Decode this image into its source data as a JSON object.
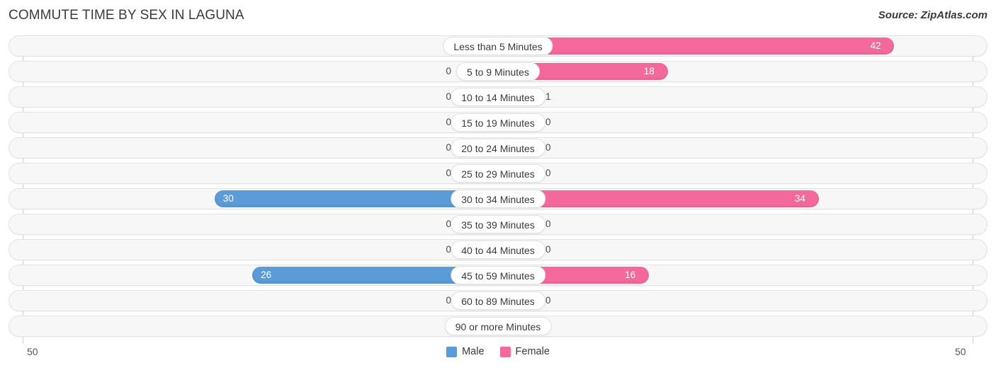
{
  "header": {
    "title": "COMMUTE TIME BY SEX IN LAGUNA",
    "source": "Source: ZipAtlas.com"
  },
  "axis": {
    "left_max_label": "50",
    "right_max_label": "50",
    "max": 50
  },
  "legend": {
    "items": [
      {
        "label": "Male",
        "color": "#5b9bd8"
      },
      {
        "label": "Female",
        "color": "#f4699b"
      }
    ]
  },
  "colors": {
    "male": "#5b9bd8",
    "male_zero": "#a8c8ea",
    "female": "#f4699b",
    "female_zero": "#f8a8c2",
    "track": "#f7f7f7",
    "track_border": "#e3e3e3"
  },
  "chart_data": {
    "type": "bar",
    "subtype": "diverging-horizontal-bar",
    "title": "COMMUTE TIME BY SEX IN LAGUNA",
    "xlabel": "",
    "ylabel": "",
    "xlim": [
      -50,
      50
    ],
    "grid": false,
    "legend_position": "bottom-center",
    "axis_tick_labels": [
      "50",
      "50"
    ],
    "categories": [
      "Less than 5 Minutes",
      "5 to 9 Minutes",
      "10 to 14 Minutes",
      "15 to 19 Minutes",
      "20 to 24 Minutes",
      "25 to 29 Minutes",
      "30 to 34 Minutes",
      "35 to 39 Minutes",
      "40 to 44 Minutes",
      "45 to 59 Minutes",
      "60 to 89 Minutes",
      "90 or more Minutes"
    ],
    "series": [
      {
        "name": "Male",
        "side": "left",
        "color": "#5b9bd8",
        "values": [
          0,
          0,
          0,
          0,
          0,
          0,
          30,
          0,
          0,
          26,
          0,
          0
        ]
      },
      {
        "name": "Female",
        "side": "right",
        "color": "#f4699b",
        "values": [
          42,
          18,
          1,
          0,
          0,
          0,
          34,
          0,
          0,
          16,
          0,
          0
        ]
      }
    ]
  },
  "rows": [
    {
      "category": "Less than 5 Minutes",
      "male": "0",
      "female": "42"
    },
    {
      "category": "5 to 9 Minutes",
      "male": "0",
      "female": "18"
    },
    {
      "category": "10 to 14 Minutes",
      "male": "0",
      "female": "1"
    },
    {
      "category": "15 to 19 Minutes",
      "male": "0",
      "female": "0"
    },
    {
      "category": "20 to 24 Minutes",
      "male": "0",
      "female": "0"
    },
    {
      "category": "25 to 29 Minutes",
      "male": "0",
      "female": "0"
    },
    {
      "category": "30 to 34 Minutes",
      "male": "30",
      "female": "34"
    },
    {
      "category": "35 to 39 Minutes",
      "male": "0",
      "female": "0"
    },
    {
      "category": "40 to 44 Minutes",
      "male": "0",
      "female": "0"
    },
    {
      "category": "45 to 59 Minutes",
      "male": "26",
      "female": "16"
    },
    {
      "category": "60 to 89 Minutes",
      "male": "0",
      "female": "0"
    },
    {
      "category": "90 or more Minutes",
      "male": "0",
      "female": "0"
    }
  ]
}
